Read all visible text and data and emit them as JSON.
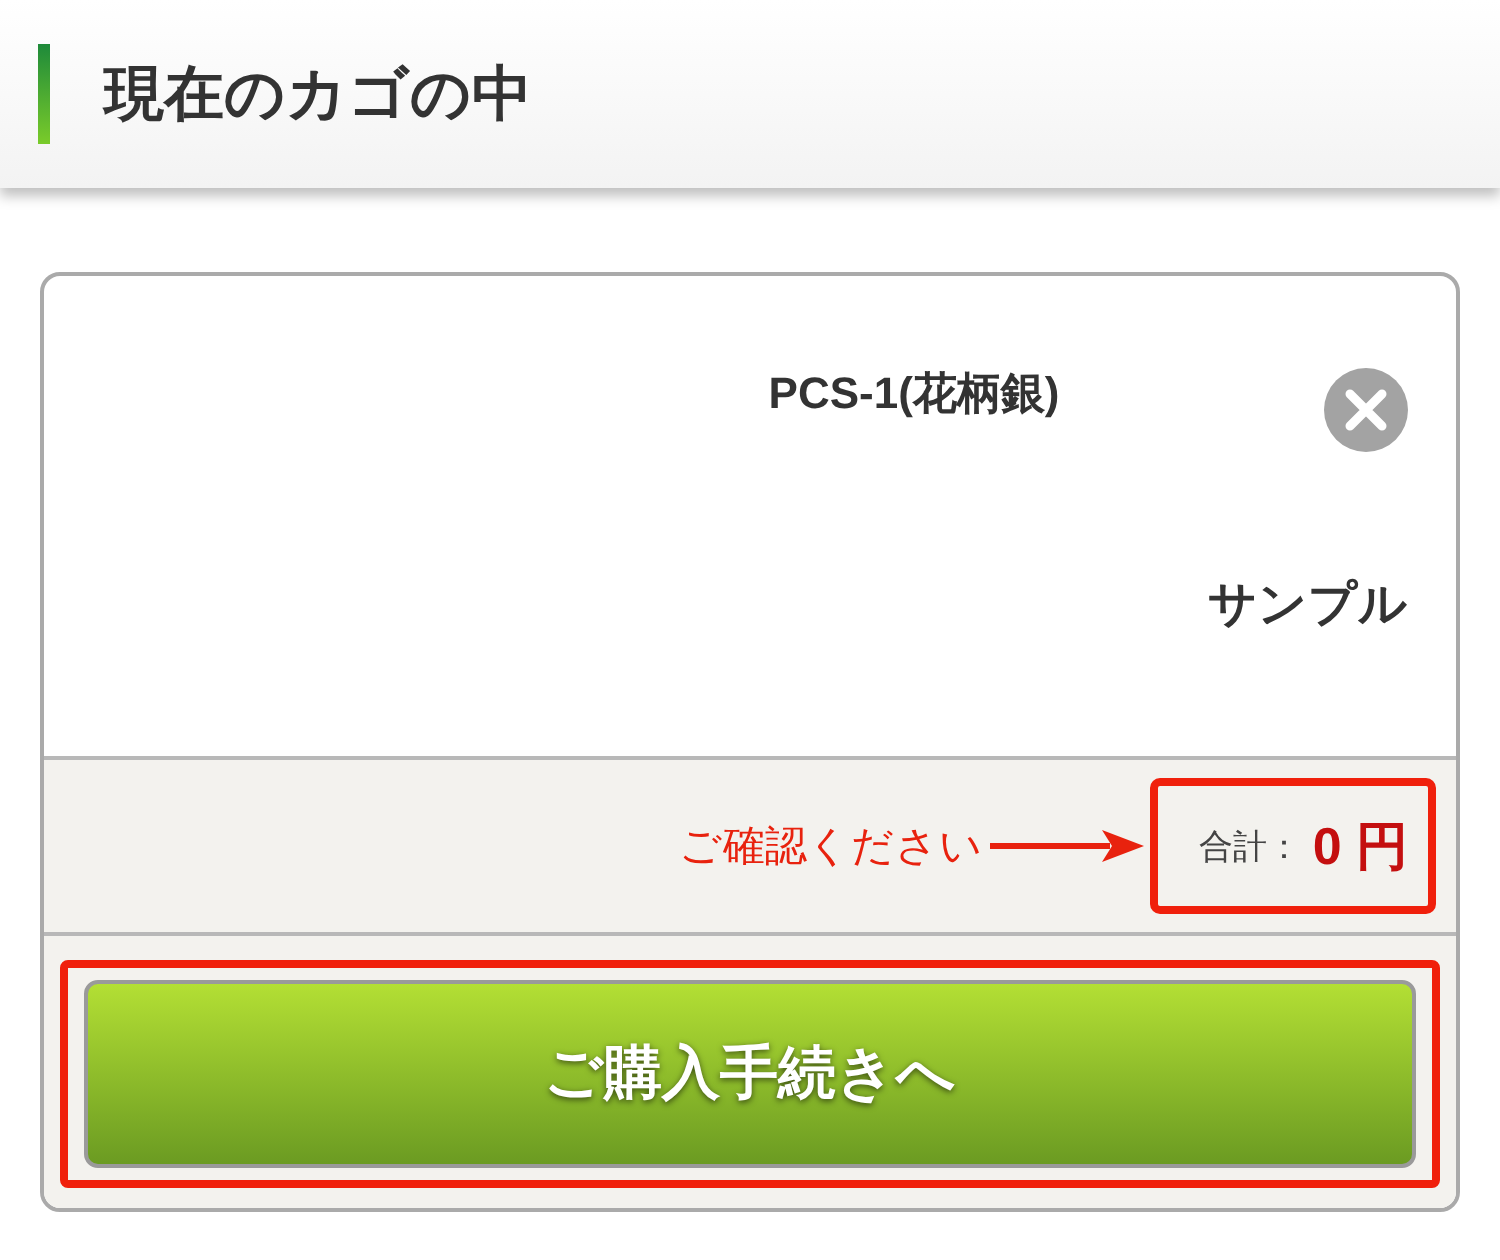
{
  "header": {
    "title": "現在のカゴの中"
  },
  "cart": {
    "items": [
      {
        "name": "PCS-1(花柄銀)",
        "note": "サンプル"
      }
    ],
    "total": {
      "label": "合計：",
      "amount": "0 円",
      "highlighted": true
    },
    "annotation": {
      "text": "ご確認ください"
    },
    "checkout_button": {
      "label": "ご購入手続きへ",
      "highlighted": true
    }
  }
}
